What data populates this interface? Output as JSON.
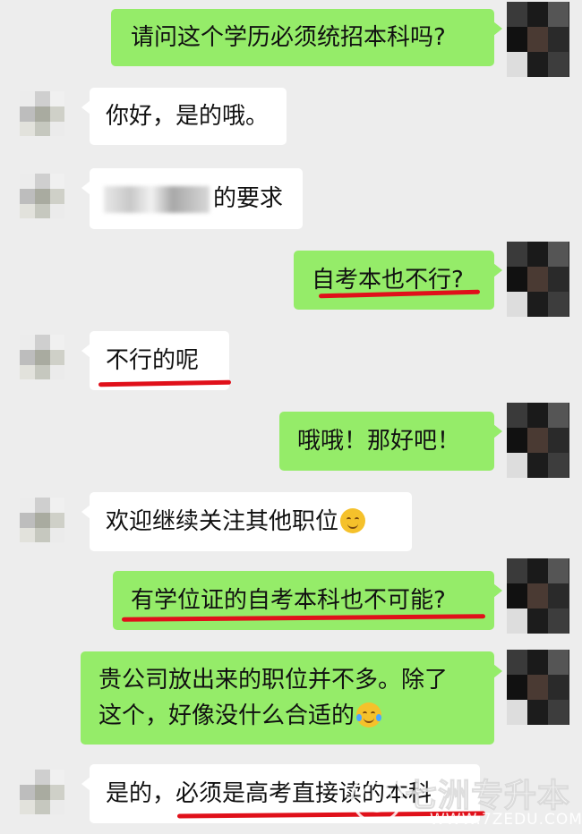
{
  "messages": [
    {
      "id": "m1",
      "side": "out",
      "text": "请问这个学历必须统招本科吗?"
    },
    {
      "id": "m2",
      "side": "in",
      "text": "你好，是的哦。"
    },
    {
      "id": "m3",
      "side": "in",
      "text": "的要求",
      "note": "leading text is pixelated/obscured"
    },
    {
      "id": "m4",
      "side": "out",
      "text": "自考本也不行?",
      "underlined": true
    },
    {
      "id": "m5",
      "side": "in",
      "text": "不行的呢",
      "underlined": true
    },
    {
      "id": "m6",
      "side": "out",
      "text": "哦哦！那好吧！"
    },
    {
      "id": "m7",
      "side": "in",
      "text": "欢迎继续关注其他职位",
      "emoji": "smile-emoji"
    },
    {
      "id": "m8",
      "side": "out",
      "text": "有学位证的自考本科也不可能?",
      "underlined": true
    },
    {
      "id": "m9",
      "side": "out",
      "lines": [
        "贵公司放出来的职位并不多。除了",
        "这个，好像没什么合适的"
      ],
      "emoji": "laugh-cry-emoji"
    },
    {
      "id": "m10",
      "side": "in",
      "text": "是的，必须是高考直接读的本科",
      "underlined": true
    }
  ],
  "watermark": {
    "title": "七洲专升本",
    "url": "WWW.7ZEDU.COM"
  },
  "colors": {
    "background": "#ededed",
    "incoming_bubble": "#ffffff",
    "outgoing_bubble": "#95ec69",
    "underline": "#e0101a"
  },
  "icons": {
    "incoming_avatar": "pixelated-avatar",
    "outgoing_avatar": "pixelated-avatar"
  }
}
